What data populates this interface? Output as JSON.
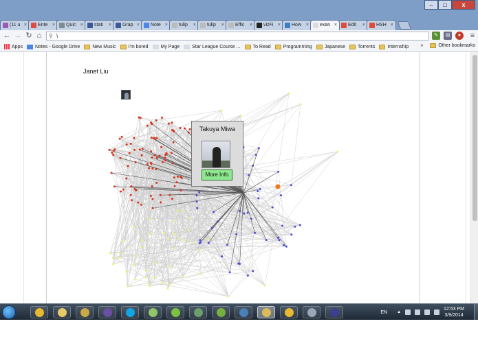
{
  "browser": {
    "tabs": [
      {
        "label": "(11 u",
        "color": "#9b59b6"
      },
      {
        "label": "Ente",
        "color": "#e04b3c"
      },
      {
        "label": "Quic",
        "color": "#7f8c8d"
      },
      {
        "label": "stati",
        "color": "#3b5998"
      },
      {
        "label": "Grap",
        "color": "#3b5998"
      },
      {
        "label": "Note",
        "color": "#4a86e8"
      },
      {
        "label": "tulip",
        "color": "#bbbbbb"
      },
      {
        "label": "tulip",
        "color": "#bbbbbb"
      },
      {
        "label": "Effic",
        "color": "#bbbbbb"
      },
      {
        "label": "vizFi",
        "color": "#222222"
      },
      {
        "label": "How",
        "color": "#3c7dc4"
      },
      {
        "label": "exan",
        "color": "#dddddd"
      },
      {
        "label": "Edit",
        "color": "#e04b3c"
      },
      {
        "label": "HSH",
        "color": "#e04b3c"
      }
    ],
    "tab_close_glyph": "×",
    "window_controls": {
      "minimize": "–",
      "maximize": "□",
      "close": "x"
    },
    "address": "\\",
    "bookmarks": [
      {
        "label": "Apps",
        "kind": "apps"
      },
      {
        "label": "Notes - Google Drive",
        "kind": "doc"
      },
      {
        "label": "New Music",
        "kind": "folder"
      },
      {
        "label": "I'm bored",
        "kind": "folder"
      },
      {
        "label": "My Page",
        "kind": "page"
      },
      {
        "label": "Star League Course ...",
        "kind": "page"
      },
      {
        "label": "To Read",
        "kind": "folder"
      },
      {
        "label": "Programming",
        "kind": "folder"
      },
      {
        "label": "Japanese",
        "kind": "folder"
      },
      {
        "label": "Torrents",
        "kind": "folder"
      },
      {
        "label": "Internship",
        "kind": "folder"
      }
    ],
    "bookmarks_overflow": "»",
    "other_bookmarks": "Other bookmarks"
  },
  "page": {
    "user_name": "Janet Liu",
    "popup": {
      "name": "Takuya Miwa",
      "button_label": "More Info"
    }
  },
  "taskbar": {
    "language": "EN",
    "time": "12:53 PM",
    "date": "3/9/2014",
    "pinned_icons": [
      {
        "name": "chrome-icon",
        "color": "#e8b830"
      },
      {
        "name": "file-explorer-icon",
        "color": "#e8c96a"
      },
      {
        "name": "league-of-legends-icon",
        "color": "#c9a84a"
      },
      {
        "name": "eclipse-icon",
        "color": "#6a4fa3"
      },
      {
        "name": "skype-icon",
        "color": "#12a5e6"
      },
      {
        "name": "notepad-icon",
        "color": "#8fc46b"
      },
      {
        "name": "spotify-icon",
        "color": "#7cc142"
      },
      {
        "name": "terminal-icon",
        "color": "#6c9d6c"
      },
      {
        "name": "utorrent-icon",
        "color": "#77b042"
      },
      {
        "name": "app-icon",
        "color": "#4a7fb8"
      },
      {
        "name": "paint-icon",
        "color": "#dcbb5a"
      },
      {
        "name": "chrome-icon-2",
        "color": "#e8b830"
      },
      {
        "name": "game-icon",
        "color": "#9aa6b8"
      },
      {
        "name": "eclipse-icon-2",
        "color": "#3a3f8f"
      }
    ]
  },
  "graph_colors": {
    "red": "#d9331b",
    "blue": "#4a4ad6",
    "yellow": "#eef08a",
    "edge": "#cfcfcf",
    "spoke": "#555555",
    "highlight": "#f07a1a"
  }
}
